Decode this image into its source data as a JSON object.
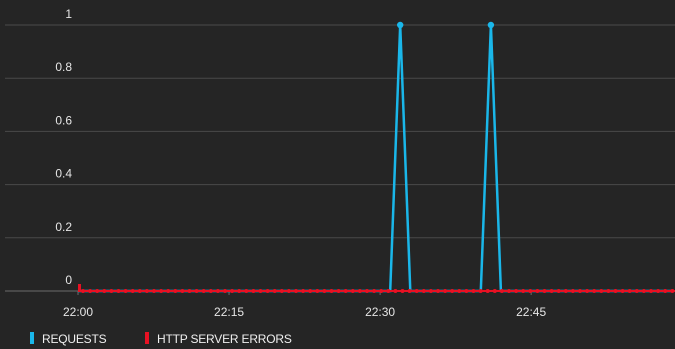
{
  "chart_data": {
    "type": "line",
    "x_ticks": [
      "22:00",
      "22:15",
      "22:30",
      "22:45"
    ],
    "y_ticks": [
      "0",
      "0.2",
      "0.4",
      "0.6",
      "0.8",
      "1"
    ],
    "ylim": [
      0,
      1
    ],
    "xlim_minutes": [
      0,
      59
    ],
    "grid": true,
    "legend_position": "bottom-left",
    "series": [
      {
        "name": "REQUESTS",
        "color": "#1ab7ea",
        "x_minutes": [
          0,
          31,
          32,
          33,
          40,
          41,
          42,
          59
        ],
        "values": [
          0,
          0,
          1,
          0,
          0,
          1,
          0,
          0
        ],
        "markers": [
          [
            32,
            1
          ],
          [
            41,
            1
          ]
        ]
      },
      {
        "name": "HTTP SERVER ERRORS",
        "color": "#e81123",
        "x_minutes": [
          0,
          59
        ],
        "values": [
          0,
          0
        ],
        "dotted_markers": true
      }
    ]
  }
}
